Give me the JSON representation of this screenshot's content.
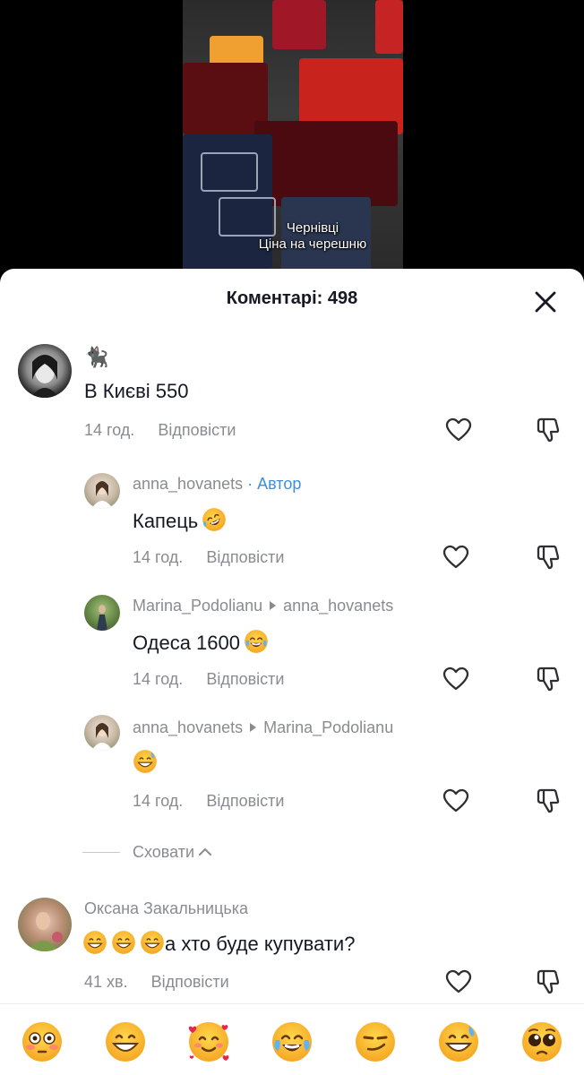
{
  "video": {
    "caption_line1": "Чернівці",
    "caption_line2": "Ціна на черешню"
  },
  "comments_header": {
    "title": "Коментарі: 498"
  },
  "comments": [
    {
      "username": "🐈‍⬛",
      "text": "В Києві 550",
      "time": "14 год.",
      "reply_label": "Відповісти",
      "replies": [
        {
          "username": "anna_hovanets",
          "author_badge": "· Автор",
          "text": "Капець",
          "text_emoji": "rofl-emoji",
          "time": "14 год.",
          "reply_label": "Відповісти"
        },
        {
          "username": "Marina_Podolianu",
          "reply_to": "anna_hovanets",
          "text": "Одеса 1600",
          "text_emoji": "joy-emoji",
          "time": "14 год.",
          "reply_label": "Відповісти"
        },
        {
          "username": "anna_hovanets",
          "reply_to": "Marina_Podolianu",
          "text": "",
          "text_emoji": "sweat-smile-emoji",
          "time": "14 год.",
          "reply_label": "Відповісти"
        }
      ],
      "hide_label": "Сховати"
    },
    {
      "username": "Оксана Закальницька",
      "text": "а хто буде купувати?",
      "text_emoji": "grin-emoji x3",
      "time": "41 хв.",
      "reply_label": "Відповісти"
    }
  ],
  "emoji_bar": [
    "flushed-emoji",
    "grin-emoji",
    "smiling-hearts-emoji",
    "joy-emoji",
    "smirk-emoji",
    "sweat-smile-emoji",
    "pleading-emoji"
  ],
  "colors": {
    "sheet_bg": "#ffffff",
    "primary_text": "#161823",
    "secondary_text": "#8a8b91",
    "author_accent": "#3e8fdb"
  }
}
